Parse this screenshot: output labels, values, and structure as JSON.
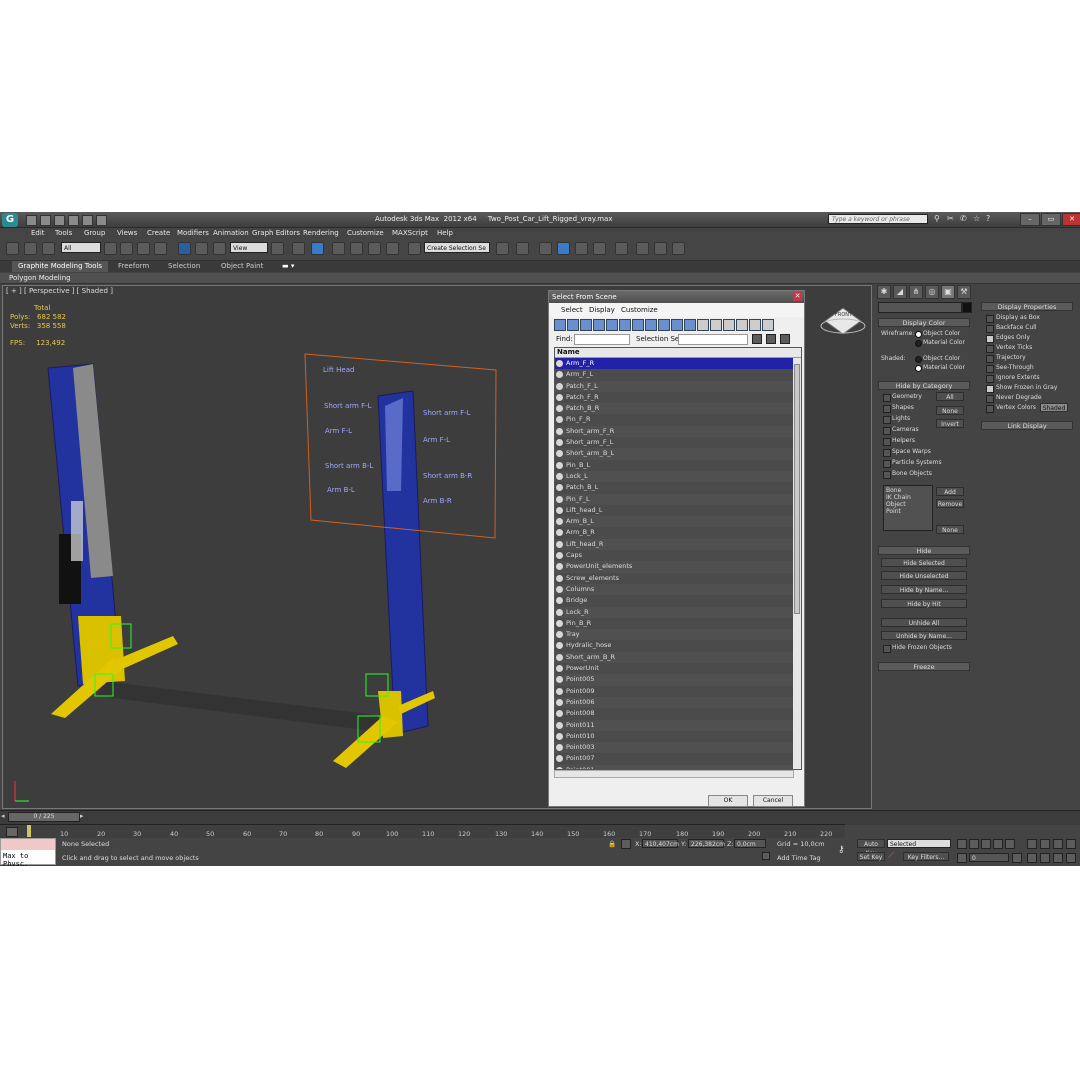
{
  "app": {
    "title": "Autodesk 3ds Max  2012 x64     Two_Post_Car_Lift_Rigged_vray.max",
    "search_placeholder": "Type a keyword or phrase"
  },
  "menu": [
    "Edit",
    "Tools",
    "Group",
    "Views",
    "Create",
    "Modifiers",
    "Animation",
    "Graph Editors",
    "Rendering",
    "Customize",
    "MAXScript",
    "Help"
  ],
  "toolbar": {
    "filter_value": "All",
    "refcoord_value": "View",
    "selection_set_placeholder": "Create Selection Se"
  },
  "ribbon": {
    "tabs": [
      "Graphite Modeling Tools",
      "Freeform",
      "Selection",
      "Object Paint"
    ],
    "sub": "Polygon Modeling"
  },
  "viewport": {
    "label": "[ + ] [ Perspective ] [ Shaded ]",
    "stats": {
      "total_label": "Total",
      "polys_label": "Polys:",
      "polys_value": "682 582",
      "verts_label": "Verts:",
      "verts_value": "358 558",
      "fps_label": "FPS:",
      "fps_value": "123,492"
    },
    "rig_panel": {
      "left": [
        "Lift Head",
        "Short arm F-L",
        "Arm F-L",
        "Short arm B-L",
        "Arm B-L"
      ],
      "right": [
        "Short arm F-L",
        "Arm F-L",
        "Short arm B-R",
        "Arm B-R"
      ]
    },
    "viewcube_label": "FRONT"
  },
  "dialog": {
    "title": "Select From Scene",
    "menu": [
      "Select",
      "Display",
      "Customize"
    ],
    "find_label": "Find:",
    "selection_set_label": "Selection Set:",
    "list_header": "Name",
    "items": [
      "Arm_F_R",
      "Arm_F_L",
      "Patch_F_L",
      "Patch_F_R",
      "Patch_B_R",
      "Pin_F_R",
      "Short_arm_F_R",
      "Short_arm_F_L",
      "Short_arm_B_L",
      "Pin_B_L",
      "Lock_L",
      "Patch_B_L",
      "Pin_F_L",
      "Lift_head_L",
      "Arm_B_L",
      "Arm_B_R",
      "Lift_head_R",
      "Caps",
      "PowerUnit_elements",
      "Screw_elements",
      "Columns",
      "Bridge",
      "Lock_R",
      "Pin_B_R",
      "Tray",
      "Hydralic_hose",
      "Short_arm_B_R",
      "PowerUnit",
      "Point005",
      "Point009",
      "Point006",
      "Point008",
      "Point011",
      "Point010",
      "Point003",
      "Point007",
      "Point001"
    ],
    "ok": "OK",
    "cancel": "Cancel"
  },
  "command_panel": {
    "display_color": "Display Color",
    "wireframe": "Wireframe:",
    "shaded": "Shaded:",
    "object_color": "Object Color",
    "material_color": "Material Color",
    "hide_by_category": "Hide by Category",
    "categories": [
      "Geometry",
      "Shapes",
      "Lights",
      "Cameras",
      "Helpers",
      "Space Warps",
      "Particle Systems",
      "Bone Objects"
    ],
    "btn_all": "All",
    "btn_none": "None",
    "btn_invert": "Invert",
    "list_items": [
      "Bone",
      "IK Chain Object",
      "Point"
    ],
    "btn_add": "Add",
    "btn_remove": "Remove",
    "btn_none2": "None",
    "hide": "Hide",
    "hide_selected": "Hide Selected",
    "hide_unselected": "Hide Unselected",
    "hide_by_name": "Hide by Name...",
    "hide_by_hit": "Hide by Hit",
    "unhide_all": "Unhide All",
    "unhide_by_name": "Unhide by Name...",
    "hide_frozen": "Hide Frozen Objects",
    "freeze": "Freeze"
  },
  "display_props": {
    "title": "Display Properties",
    "items": [
      "Display as Box",
      "Backface Cull",
      "Edges Only",
      "Vertex Ticks",
      "Trajectory",
      "See-Through",
      "Ignore Extents",
      "Show Frozen in Gray",
      "Never Degrade",
      "Vertex Colors"
    ],
    "shaded_btn": "Shaded",
    "link_display": "Link Display"
  },
  "timeline": {
    "frame": "0 / 225",
    "ticks": [
      "10",
      "20",
      "30",
      "40",
      "50",
      "60",
      "70",
      "80",
      "90",
      "100",
      "110",
      "120",
      "130",
      "140",
      "150",
      "160",
      "170",
      "180",
      "190",
      "200",
      "210",
      "220"
    ]
  },
  "status": {
    "script_label": "Max to Physc.",
    "none_selected": "None Selected",
    "prompt": "Click and drag to select and move objects",
    "x_label": "X:",
    "x_value": "410,407cm",
    "y_label": "Y:",
    "y_value": "226,382cm",
    "z_label": "Z:",
    "z_value": "0,0cm",
    "grid": "Grid = 10,0cm",
    "add_time_tag": "Add Time Tag",
    "auto_key": "Auto Key",
    "set_key": "Set Key",
    "selected_value": "Selected",
    "key_filters": "Key Filters...",
    "frame_value": "0"
  }
}
